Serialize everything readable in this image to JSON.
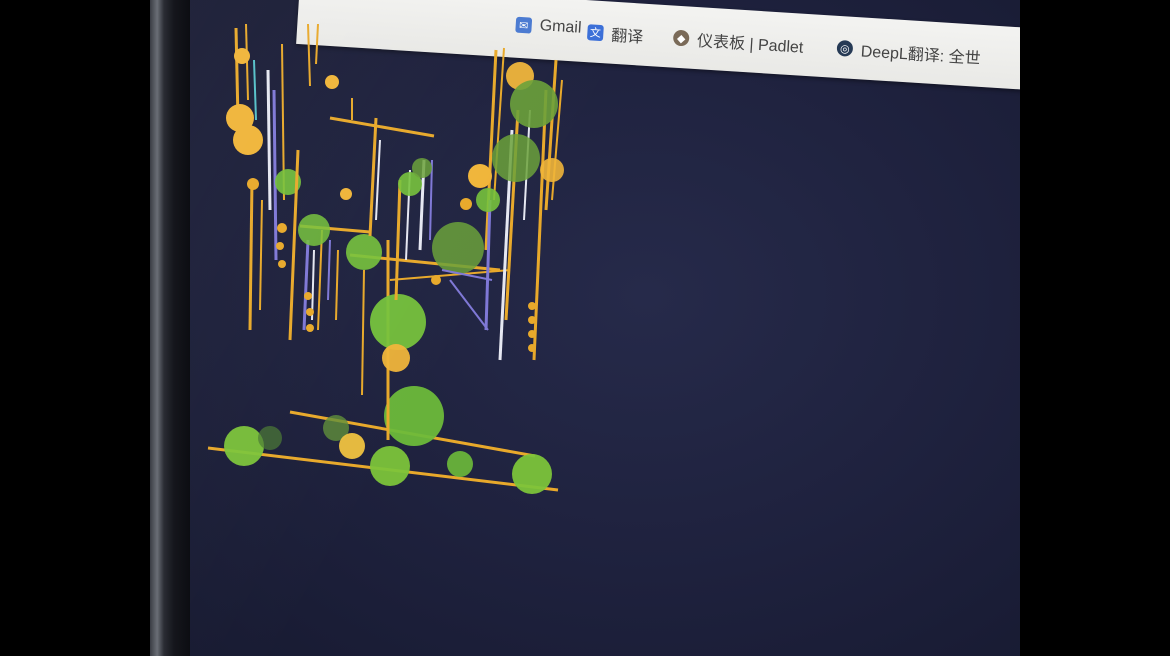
{
  "bookmarks": [
    {
      "label": "Gmail",
      "icon": "mail-icon",
      "color": "#4a7ad1"
    },
    {
      "label": "翻译",
      "icon": "translate-icon",
      "color": "#3b6fd8"
    },
    {
      "label": "仪表板 | Padlet",
      "icon": "padlet-icon",
      "color": "#7a6a58"
    },
    {
      "label": "DeepL翻译: 全世",
      "icon": "deepl-icon",
      "color": "#263a55"
    }
  ],
  "colors": {
    "screen_bg": "#1e213d",
    "line_orange": "#e8a92b",
    "line_white": "#e6e8f2",
    "line_purple": "#7f78d6",
    "circle_green": "#7cc43a",
    "circle_yellow": "#f0b53a"
  }
}
